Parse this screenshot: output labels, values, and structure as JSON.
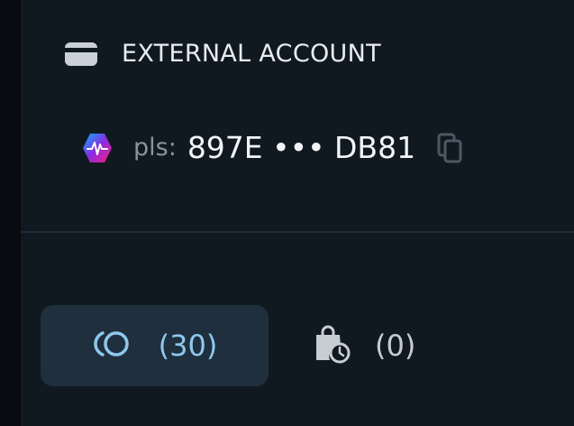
{
  "header": {
    "icon": "wallet-icon",
    "title": "EXTERNAL ACCOUNT"
  },
  "account": {
    "chain_icon": "pulsechain-icon",
    "prefix": "pls:",
    "address": "897E ••• DB81",
    "copy_icon": "copy-icon"
  },
  "tabs": [
    {
      "icon": "tokens-icon",
      "count": "(30)",
      "active": true
    },
    {
      "icon": "pending-bag-clock-icon",
      "count": "(0)",
      "active": false
    }
  ],
  "colors": {
    "background": "#111920",
    "active_tab": "#1f2f3d",
    "accent": "#8fc8ee"
  }
}
